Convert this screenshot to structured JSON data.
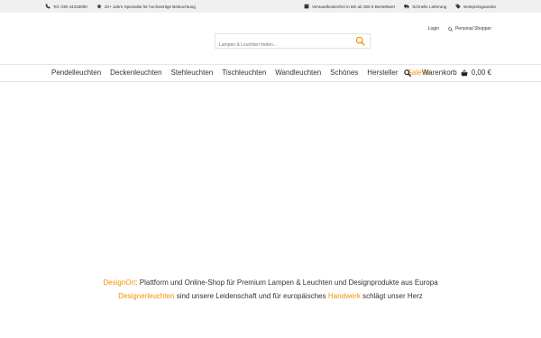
{
  "topbar": {
    "left": [
      {
        "icon": "phone-icon",
        "text": "Tel: 030 44318090"
      },
      {
        "icon": "star-icon",
        "text": "20+ Jahre Spezialist für hochwertige Beleuchtung"
      }
    ],
    "right": [
      {
        "icon": "shipping-box-icon",
        "text": "Versandkostenfrei in DE ab 300 € Bestellwert"
      },
      {
        "icon": "truck-icon",
        "text": "Schnelle Lieferung"
      },
      {
        "icon": "price-tag-icon",
        "text": "Bestpreisgarantie"
      }
    ]
  },
  "search": {
    "placeholder": "Lampen & Leuchten finden..."
  },
  "account": {
    "login_label": "Login",
    "personal_shopper_label": "Personal Shopper"
  },
  "nav": {
    "items": [
      "Pendelleuchten",
      "Deckenleuchten",
      "Stehleuchten",
      "Tischleuchten",
      "Wandleuchten",
      "Schönes",
      "Hersteller",
      "Sale %"
    ],
    "cart_label": "Warenkorb",
    "cart_total": "0,00 €"
  },
  "tagline": {
    "line1_brand": "DesignOrt:",
    "line1_rest": "Plattform und Online-Shop für Premium Lampen & Leuchten und Designprodukte aus Europa",
    "line2_part1": "Designerleuchten",
    "line2_part2": "sind unsere Leidenschaft und für europäisches",
    "line2_part3": "Handwerk",
    "line2_part4": "schlägt unser Herz"
  },
  "colors": {
    "accent": "#f39200",
    "topbar_bg": "#f0f0f0",
    "text": "#333333"
  }
}
